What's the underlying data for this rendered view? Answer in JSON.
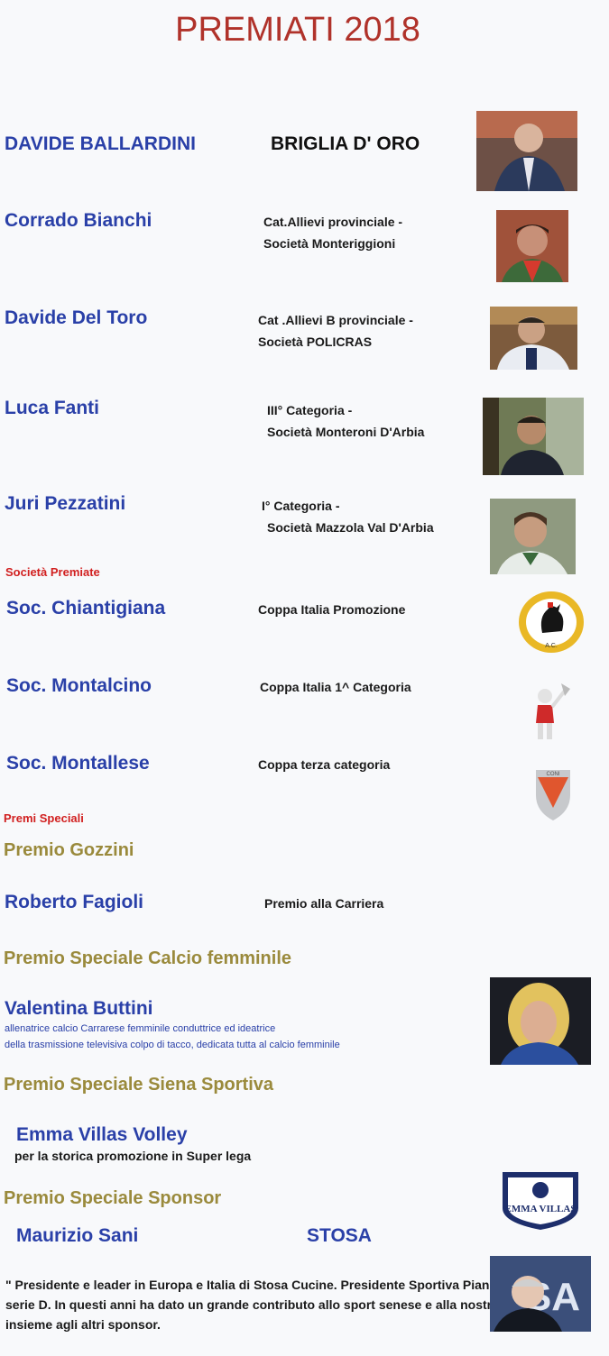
{
  "page_title": "PREMIATI 2018",
  "awardees": [
    {
      "name": "DAVIDE BALLARDINI",
      "award": "BRIGLIA D' ORO"
    },
    {
      "name": "Corrado Bianchi",
      "award_line1": "Cat.Allievi  provinciale -",
      "award_line2": "Società  Monteriggioni"
    },
    {
      "name": "Davide Del Toro",
      "award_line1": "Cat .Allievi B   provinciale -",
      "award_line2": "Società  POLICRAS"
    },
    {
      "name": "Luca Fanti",
      "award_line1": "III° Categoria -",
      "award_line2": "Società  Monteroni D'Arbia"
    },
    {
      "name": "Juri Pezzatini",
      "award_line1": "I° Categoria -",
      "award_line2": "Società  Mazzola Val D'Arbia"
    }
  ],
  "societa_heading": "Società Premiate",
  "societa": [
    {
      "name": "Soc. Chiantigiana",
      "award": "Coppa  Italia Promozione"
    },
    {
      "name": "Soc. Montalcino",
      "award": "Coppa  Italia 1^ Categoria"
    },
    {
      "name": "Soc. Montallese",
      "award": "Coppa  terza categoria"
    }
  ],
  "premi_heading": "Premi Speciali",
  "premio_gozzini": {
    "heading": "Premio Gozzini",
    "name": "Roberto Fagioli",
    "award": "Premio alla Carriera"
  },
  "calcio_femminile": {
    "heading": "Premio Speciale Calcio femminile",
    "name": "Valentina Buttini",
    "desc_line1": "allenatrice calcio Carrarese femminile conduttrice ed ideatrice",
    "desc_line2": "della trasmissione televisiva colpo di tacco, dedicata tutta al calcio femminile"
  },
  "siena_sportiva": {
    "heading": "Premio   Speciale   Siena Sportiva",
    "name": "Emma Villas Volley",
    "desc": "per la storica promozione in Super lega"
  },
  "sponsor": {
    "heading": "Premio Speciale Sponsor",
    "name": "Maurizio Sani",
    "company": "STOSA",
    "footer": "\" Presidente e leader in Europa e Italia di Stosa Cucine. Presidente Sportiva Pianese, campionato serie D. In questi anni ha dato un grande contributo allo sport senese e alla nostra associazione, insieme agli altri sponsor."
  },
  "logos": {
    "emma_villas_text": "EMMA VILLAS",
    "coni_text": "CONI"
  },
  "colors": {
    "title": "#b0322a",
    "name_blue": "#2a40a8",
    "red_heading": "#d12020",
    "gold_heading": "#9a8a3c"
  }
}
